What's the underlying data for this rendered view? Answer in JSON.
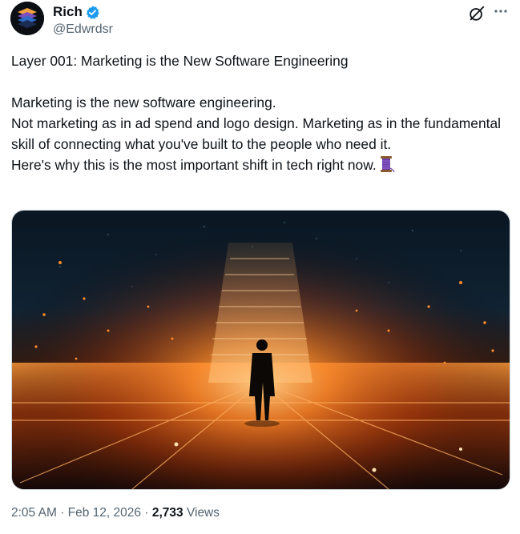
{
  "author": {
    "display_name": "Rich",
    "handle": "@Edwrdsr",
    "verified_color": "#1d9bf0"
  },
  "actions": {
    "grok_icon": "grok-icon",
    "more_icon": "more-icon"
  },
  "tweet": {
    "title_line": "Layer 001: Marketing is the New Software Engineering",
    "lines": [
      "Marketing is the new software engineering.",
      "Not marketing as in ad spend and logo design. Marketing as in the fundamental skill of connecting what you've built to the people who need it.",
      "Here's why this is the most important shift in tech right now."
    ],
    "thread_emoji": "thread-spool-icon"
  },
  "media": {
    "image_icon": "silhouette-figure-code-grid-image"
  },
  "meta": {
    "time": "2:05 AM",
    "separator": "·",
    "date": "Feb 12, 2026",
    "views_count": "2,733",
    "views_label": "Views"
  },
  "colors": {
    "text_primary": "#0f1419",
    "text_secondary": "#536471",
    "accent": "#1d9bf0",
    "glow": "#ff8a2a"
  }
}
